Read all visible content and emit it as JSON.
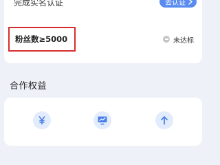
{
  "requirements": [
    {
      "label": "完成实名认证",
      "action_label": "去认证"
    },
    {
      "label": "粉丝数≥5000",
      "status": "未达标"
    }
  ],
  "benefits_section": {
    "title": "合作权益",
    "icons": [
      "yuan-icon",
      "monitor-chart-icon",
      "arrow-up-icon"
    ]
  },
  "colors": {
    "accent": "#5a8cf0",
    "highlight_border": "#d92c2c",
    "background": "#eef1f8",
    "icon_bg": "#e3ecfc"
  }
}
